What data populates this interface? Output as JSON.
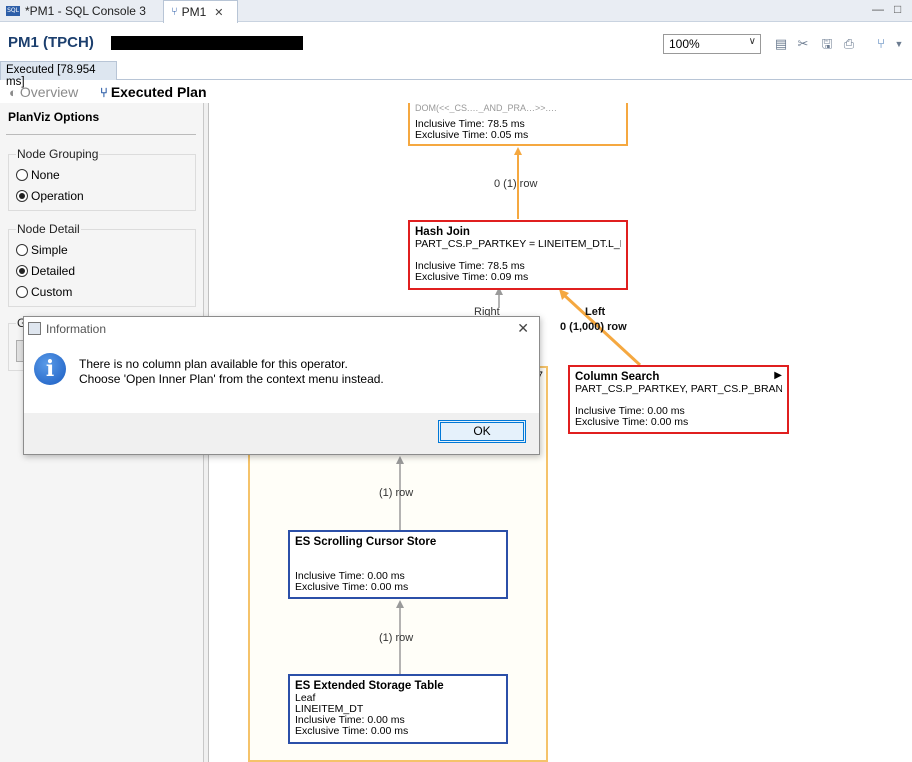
{
  "tabs": [
    {
      "label": "*PM1 - SQL Console 3",
      "icon": "sql-icon"
    },
    {
      "label": "PM1",
      "icon": "plan-icon"
    }
  ],
  "editor": {
    "title": "PM1 (TPCH)",
    "zoom": "100%",
    "status": "Executed [78.954 ms]"
  },
  "view_tabs": {
    "overview": "Overview",
    "executed": "Executed Plan"
  },
  "options": {
    "title": "PlanViz Options",
    "node_grouping": {
      "label": "Node Grouping",
      "options": [
        "None",
        "Operation"
      ],
      "selected": "Operation"
    },
    "node_detail": {
      "label": "Node Detail",
      "options": [
        "Simple",
        "Detailed",
        "Custom"
      ],
      "selected": "Detailed"
    },
    "partial_label": "G"
  },
  "plan": {
    "top_node": {
      "partial": "DOM(<<_CS.…_AND_PRA…>>.…",
      "inclusive": "Inclusive Time: 78.5 ms",
      "exclusive": "Exclusive Time: 0.05 ms"
    },
    "edge_top": "0 (1) row",
    "hash_join": {
      "title": "Hash Join",
      "detail": "PART_CS.P_PARTKEY = LINEITEM_DT.L_PA...",
      "inclusive": "Inclusive Time: 78.5 ms",
      "exclusive": "Exclusive Time: 0.09 ms"
    },
    "edge_right": "Right",
    "edge_left": "Left",
    "edge_left_rows": "0 (1,000) row",
    "column_search": {
      "title": "Column Search",
      "detail": "PART_CS.P_PARTKEY, PART_CS.P_BRAND, ...",
      "inclusive": "Inclusive Time: 0.00 ms",
      "exclusive": "Exclusive Time: 0.00 ms"
    },
    "bigbox_corner": "7",
    "edge_rows_1": "(1) row",
    "cursor_store": {
      "title": "ES Scrolling Cursor Store",
      "inclusive": "Inclusive Time: 0.00 ms",
      "exclusive": "Exclusive Time: 0.00 ms"
    },
    "edge_rows_2": "(1) row",
    "storage_table": {
      "title": "ES Extended Storage Table",
      "line1": "Leaf",
      "line2": "LINEITEM_DT",
      "inclusive": "Inclusive Time: 0.00 ms",
      "exclusive": "Exclusive Time: 0.00 ms"
    }
  },
  "dialog": {
    "title": "Information",
    "line1": "There is no column plan available for this operator.",
    "line2": "Choose 'Open Inner Plan' from the context menu instead.",
    "ok": "OK"
  },
  "colors": {
    "accent_orange": "#f5a840",
    "node_red": "#e01f1f",
    "node_blue": "#2b4fa8",
    "title_blue": "#1c3f6e"
  }
}
